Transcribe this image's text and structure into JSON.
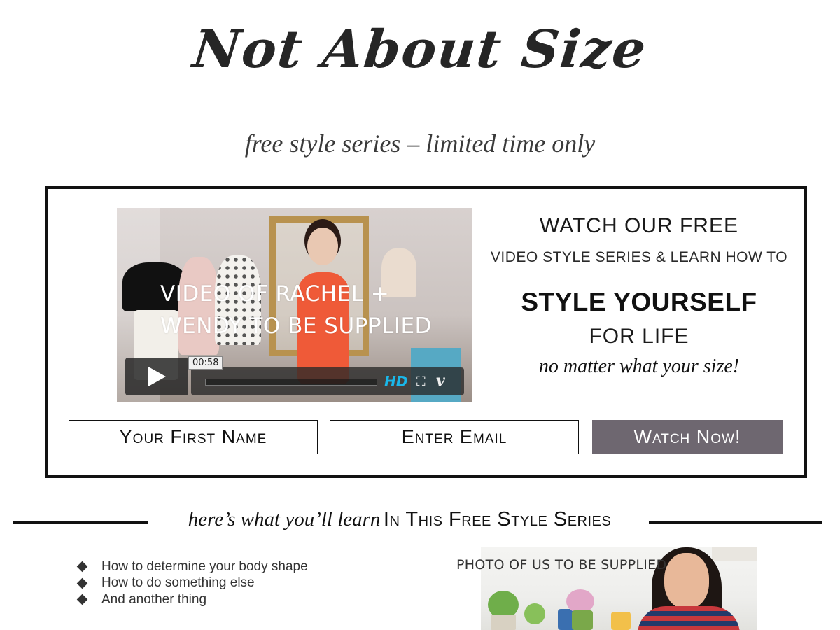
{
  "header": {
    "logo_text": "Not About Size",
    "tagline": "free style series – limited time only"
  },
  "optin": {
    "video": {
      "placeholder_text": "VIDEO OF RACHEL +\nWENDY TO BE SUPPLIED",
      "timestamp": "00:58",
      "hd_label": "HD",
      "fullscreen_glyph": "⛶",
      "vimeo_label": "v",
      "icons": [
        "play-icon",
        "fullscreen-icon",
        "vimeo-logo-icon"
      ]
    },
    "pitch": {
      "line1": "WATCH OUR FREE",
      "line2": "VIDEO STYLE SERIES & LEARN HOW TO",
      "line3": "STYLE YOURSELF",
      "line4": "FOR LIFE",
      "line5": "no matter what your size!"
    },
    "form": {
      "first_name_placeholder": "Your First Name",
      "email_placeholder": "Enter Email",
      "submit_label": "Watch Now!"
    }
  },
  "learn": {
    "heading_italic": "here’s what you’ll learn",
    "heading_caps": "In This Free Style Series",
    "bullets": [
      "How to determine your body shape",
      "How to do something else",
      "And another thing"
    ],
    "photo_placeholder_text": "PHOTO OF US TO BE SUPPLIED"
  },
  "colors": {
    "button_bg": "#6e6770",
    "box_border": "#111111",
    "hd_blue": "#1ab7ea"
  }
}
